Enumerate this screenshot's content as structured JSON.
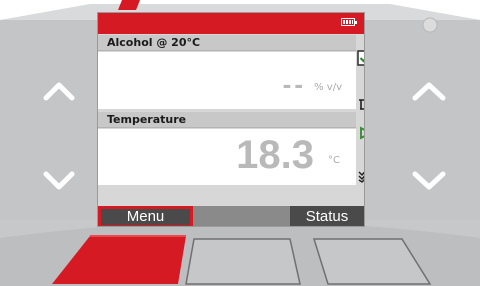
{
  "colors": {
    "accent": "#d51a24",
    "softkey_dark": "#4a4a4a",
    "softkey_mid": "#8a8a8a",
    "value_gray": "#b9b9b9",
    "check_green": "#2e8b2e"
  },
  "status_bar": {
    "battery_icon": "battery-full-icon"
  },
  "measurements": [
    {
      "label": "Alcohol @ 20°C",
      "value": "--",
      "unit": "% v/v"
    },
    {
      "label": "Temperature",
      "value": "18.3",
      "unit": "°C"
    }
  ],
  "side_icons": [
    "checkbox-checked-icon",
    "sample-changer-icon",
    "play-icon",
    "multi-check-icon"
  ],
  "softkeys": {
    "left": "Menu",
    "middle": "",
    "right": "Status"
  },
  "hardware_buttons": [
    "up-arrow-left",
    "down-arrow-left",
    "up-arrow-right",
    "down-arrow-right",
    "red-function-key",
    "function-key-2",
    "function-key-3"
  ]
}
